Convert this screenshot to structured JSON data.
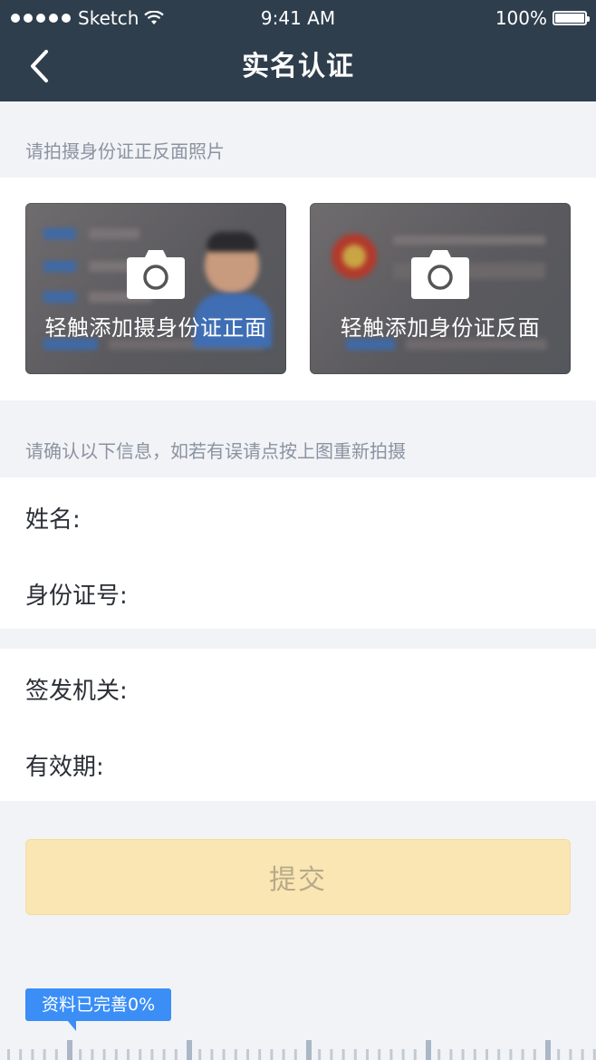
{
  "status_bar": {
    "carrier": "Sketch",
    "time": "9:41 AM",
    "battery": "100%"
  },
  "nav": {
    "title": "实名认证",
    "back_icon": "chevron-left-icon"
  },
  "photo_section": {
    "hint": "请拍摄身份证正反面照片",
    "front_label": "轻触添加摄身份证正面",
    "back_label": "轻触添加身份证反面",
    "camera_icon": "camera-icon"
  },
  "confirm_section": {
    "hint": "请确认以下信息，如若有误请点按上图重新拍摄"
  },
  "fields": {
    "name_label": "姓名:",
    "id_number_label": "身份证号:",
    "issuer_label": "签发机关:",
    "validity_label": "有效期:"
  },
  "submit": {
    "label": "提交"
  },
  "progress": {
    "label": "资料已完善0%",
    "value": 0
  },
  "colors": {
    "nav_bg": "#2f3e4d",
    "submit_bg": "#f9e6b3",
    "accent": "#3a8ef6"
  }
}
